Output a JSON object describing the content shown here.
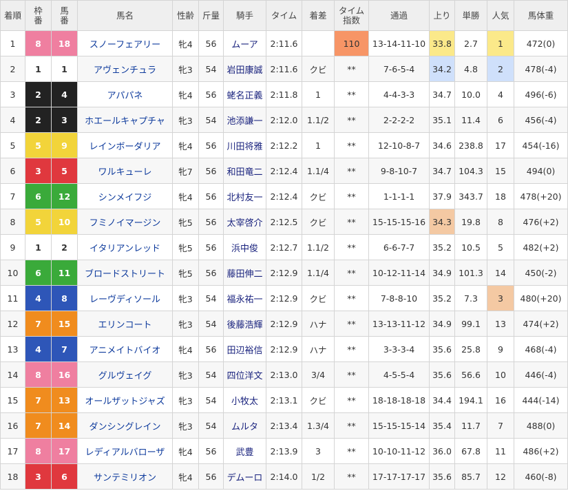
{
  "columns": [
    "着順",
    "枠番",
    "馬番",
    "馬名",
    "性齢",
    "斤量",
    "騎手",
    "タイム",
    "着差",
    "タイム指数",
    "通過",
    "上り",
    "単勝",
    "人気",
    "馬体重"
  ],
  "header_multiline": {
    "waku": [
      "枠",
      "番"
    ],
    "uma": [
      "馬",
      "番"
    ],
    "index": [
      "タイム",
      "指数"
    ]
  },
  "waku_colors": {
    "1": {
      "bg": "#ffffff",
      "fg": "#333333"
    },
    "2": {
      "bg": "#222222",
      "fg": "#ffffff"
    },
    "3": {
      "bg": "#e0383e",
      "fg": "#ffffff"
    },
    "4": {
      "bg": "#2e56b8",
      "fg": "#ffffff"
    },
    "5": {
      "bg": "#f2d43a",
      "fg": "#ffffff"
    },
    "6": {
      "bg": "#3aaa3a",
      "fg": "#ffffff"
    },
    "7": {
      "bg": "#f08c1e",
      "fg": "#ffffff"
    },
    "8": {
      "bg": "#ef7fa0",
      "fg": "#ffffff"
    }
  },
  "rows": [
    {
      "rank": "1",
      "waku": "8",
      "uma": "18",
      "name": "スノーフェアリー",
      "sexage": "牝4",
      "kinryo": "56",
      "jockey": "ムーア",
      "time": "2:11.6",
      "margin": "",
      "index": "110",
      "pass": "13-14-11-10",
      "agari": "33.8",
      "odds": "2.7",
      "ninki": "1",
      "weight": "472(0)"
    },
    {
      "rank": "2",
      "waku": "1",
      "uma": "1",
      "name": "アヴェンチュラ",
      "sexage": "牝3",
      "kinryo": "54",
      "jockey": "岩田康誠",
      "time": "2:11.6",
      "margin": "クビ",
      "index": "**",
      "pass": "7-6-5-4",
      "agari": "34.2",
      "odds": "4.8",
      "ninki": "2",
      "weight": "478(-4)"
    },
    {
      "rank": "3",
      "waku": "2",
      "uma": "4",
      "name": "アパパネ",
      "sexage": "牝4",
      "kinryo": "56",
      "jockey": "蛯名正義",
      "time": "2:11.8",
      "margin": "1",
      "index": "**",
      "pass": "4-4-3-3",
      "agari": "34.7",
      "odds": "10.0",
      "ninki": "4",
      "weight": "496(-6)"
    },
    {
      "rank": "4",
      "waku": "2",
      "uma": "3",
      "name": "ホエールキャプチャ",
      "sexage": "牝3",
      "kinryo": "54",
      "jockey": "池添謙一",
      "time": "2:12.0",
      "margin": "1.1/2",
      "index": "**",
      "pass": "2-2-2-2",
      "agari": "35.1",
      "odds": "11.4",
      "ninki": "6",
      "weight": "456(-4)"
    },
    {
      "rank": "5",
      "waku": "5",
      "uma": "9",
      "name": "レインボーダリア",
      "sexage": "牝4",
      "kinryo": "56",
      "jockey": "川田将雅",
      "time": "2:12.2",
      "margin": "1",
      "index": "**",
      "pass": "12-10-8-7",
      "agari": "34.6",
      "odds": "238.8",
      "ninki": "17",
      "weight": "454(-16)"
    },
    {
      "rank": "6",
      "waku": "3",
      "uma": "5",
      "name": "ワルキューレ",
      "sexage": "牝7",
      "kinryo": "56",
      "jockey": "和田竜二",
      "time": "2:12.4",
      "margin": "1.1/4",
      "index": "**",
      "pass": "9-8-10-7",
      "agari": "34.7",
      "odds": "104.3",
      "ninki": "15",
      "weight": "494(0)"
    },
    {
      "rank": "7",
      "waku": "6",
      "uma": "12",
      "name": "シンメイフジ",
      "sexage": "牝4",
      "kinryo": "56",
      "jockey": "北村友一",
      "time": "2:12.4",
      "margin": "クビ",
      "index": "**",
      "pass": "1-1-1-1",
      "agari": "37.9",
      "odds": "343.7",
      "ninki": "18",
      "weight": "478(+20)"
    },
    {
      "rank": "8",
      "waku": "5",
      "uma": "10",
      "name": "フミノイマージン",
      "sexage": "牝5",
      "kinryo": "56",
      "jockey": "太宰啓介",
      "time": "2:12.5",
      "margin": "クビ",
      "index": "**",
      "pass": "15-15-15-16",
      "agari": "34.3",
      "odds": "19.8",
      "ninki": "8",
      "weight": "476(+2)"
    },
    {
      "rank": "9",
      "waku": "1",
      "uma": "2",
      "name": "イタリアンレッド",
      "sexage": "牝5",
      "kinryo": "56",
      "jockey": "浜中俊",
      "time": "2:12.7",
      "margin": "1.1/2",
      "index": "**",
      "pass": "6-6-7-7",
      "agari": "35.2",
      "odds": "10.5",
      "ninki": "5",
      "weight": "482(+2)"
    },
    {
      "rank": "10",
      "waku": "6",
      "uma": "11",
      "name": "ブロードストリート",
      "sexage": "牝5",
      "kinryo": "56",
      "jockey": "藤田伸二",
      "time": "2:12.9",
      "margin": "1.1/4",
      "index": "**",
      "pass": "10-12-11-14",
      "agari": "34.9",
      "odds": "101.3",
      "ninki": "14",
      "weight": "450(-2)"
    },
    {
      "rank": "11",
      "waku": "4",
      "uma": "8",
      "name": "レーヴディソール",
      "sexage": "牝3",
      "kinryo": "54",
      "jockey": "福永祐一",
      "time": "2:12.9",
      "margin": "クビ",
      "index": "**",
      "pass": "7-8-8-10",
      "agari": "35.2",
      "odds": "7.3",
      "ninki": "3",
      "weight": "480(+20)"
    },
    {
      "rank": "12",
      "waku": "7",
      "uma": "15",
      "name": "エリンコート",
      "sexage": "牝3",
      "kinryo": "54",
      "jockey": "後藤浩輝",
      "time": "2:12.9",
      "margin": "ハナ",
      "index": "**",
      "pass": "13-13-11-12",
      "agari": "34.9",
      "odds": "99.1",
      "ninki": "13",
      "weight": "474(+2)"
    },
    {
      "rank": "13",
      "waku": "4",
      "uma": "7",
      "name": "アニメイトバイオ",
      "sexage": "牝4",
      "kinryo": "56",
      "jockey": "田辺裕信",
      "time": "2:12.9",
      "margin": "ハナ",
      "index": "**",
      "pass": "3-3-3-4",
      "agari": "35.6",
      "odds": "25.8",
      "ninki": "9",
      "weight": "468(-4)"
    },
    {
      "rank": "14",
      "waku": "8",
      "uma": "16",
      "name": "グルヴェイグ",
      "sexage": "牝3",
      "kinryo": "54",
      "jockey": "四位洋文",
      "time": "2:13.0",
      "margin": "3/4",
      "index": "**",
      "pass": "4-5-5-4",
      "agari": "35.6",
      "odds": "56.6",
      "ninki": "10",
      "weight": "446(-4)"
    },
    {
      "rank": "15",
      "waku": "7",
      "uma": "13",
      "name": "オールザットジャズ",
      "sexage": "牝3",
      "kinryo": "54",
      "jockey": "小牧太",
      "time": "2:13.1",
      "margin": "クビ",
      "index": "**",
      "pass": "18-18-18-18",
      "agari": "34.4",
      "odds": "194.1",
      "ninki": "16",
      "weight": "444(-14)"
    },
    {
      "rank": "16",
      "waku": "7",
      "uma": "14",
      "name": "ダンシングレイン",
      "sexage": "牝3",
      "kinryo": "54",
      "jockey": "ムルタ",
      "time": "2:13.4",
      "margin": "1.3/4",
      "index": "**",
      "pass": "15-15-15-14",
      "agari": "35.4",
      "odds": "11.7",
      "ninki": "7",
      "weight": "488(0)"
    },
    {
      "rank": "17",
      "waku": "8",
      "uma": "17",
      "name": "レディアルバローザ",
      "sexage": "牝4",
      "kinryo": "56",
      "jockey": "武豊",
      "time": "2:13.9",
      "margin": "3",
      "index": "**",
      "pass": "10-10-11-12",
      "agari": "36.0",
      "odds": "67.8",
      "ninki": "11",
      "weight": "486(+2)"
    },
    {
      "rank": "18",
      "waku": "3",
      "uma": "6",
      "name": "サンテミリオン",
      "sexage": "牝4",
      "kinryo": "56",
      "jockey": "デムーロ",
      "time": "2:14.0",
      "margin": "1/2",
      "index": "**",
      "pass": "17-17-17-17",
      "agari": "35.6",
      "odds": "85.7",
      "ninki": "12",
      "weight": "460(-8)"
    }
  ],
  "highlights": {
    "index_top": "#f79566",
    "agari_first": "#fbe98a",
    "agari_second": "#cfe0fb",
    "agari_third": "#f4c9a3",
    "ninki_first": "#fbe98a",
    "ninki_second": "#cfe0fb",
    "ninki_third": "#f4c9a3"
  }
}
